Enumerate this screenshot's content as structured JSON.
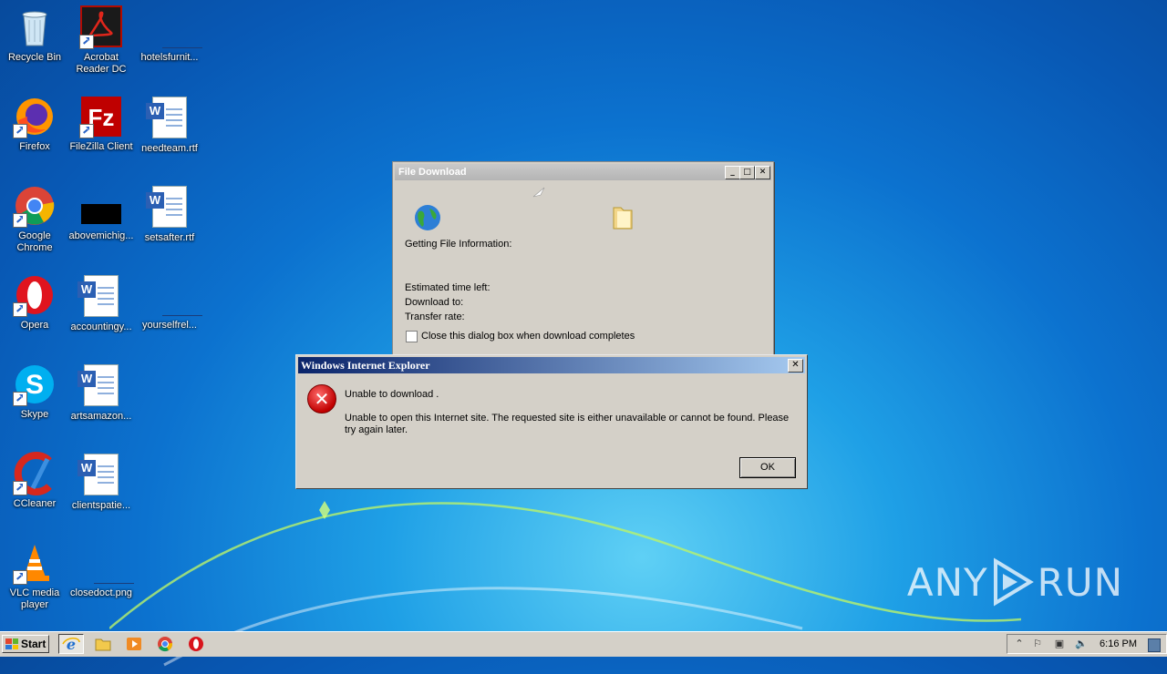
{
  "desktop": {
    "icons": [
      {
        "label": "Recycle Bin"
      },
      {
        "label": "Acrobat Reader DC"
      },
      {
        "label": "hotelsfurnit..."
      },
      {
        "label": "Firefox"
      },
      {
        "label": "FileZilla Client"
      },
      {
        "label": "needteam.rtf"
      },
      {
        "label": "Google Chrome"
      },
      {
        "label": "abovemichig..."
      },
      {
        "label": "setsafter.rtf"
      },
      {
        "label": "Opera"
      },
      {
        "label": "accountingy..."
      },
      {
        "label": "yourselfrel..."
      },
      {
        "label": "Skype"
      },
      {
        "label": "artsamazon..."
      },
      {
        "label": "CCleaner"
      },
      {
        "label": "clientspatie..."
      },
      {
        "label": "VLC media player"
      },
      {
        "label": "closedoct.png"
      }
    ]
  },
  "file_download": {
    "title": "File Download",
    "status": "Getting File Information:",
    "estimated": "Estimated time left:",
    "download_to": "Download to:",
    "transfer_rate": "Transfer rate:",
    "close_checkbox_label": "Close this dialog box when download completes",
    "close_checked": false
  },
  "ie_error": {
    "title": "Windows Internet Explorer",
    "message1": "Unable to download .",
    "message2": "Unable to open this Internet site.  The requested site is either unavailable or cannot be found.  Please try again later.",
    "ok_label": "OK"
  },
  "taskbar": {
    "start_label": "Start",
    "clock": "6:16 PM"
  },
  "watermark": {
    "text_left": "ANY",
    "text_right": "RUN"
  },
  "colors": {
    "title_active_start": "#0a246a",
    "title_active_end": "#a6caf0",
    "dialog_bg": "#d4d0c8"
  }
}
